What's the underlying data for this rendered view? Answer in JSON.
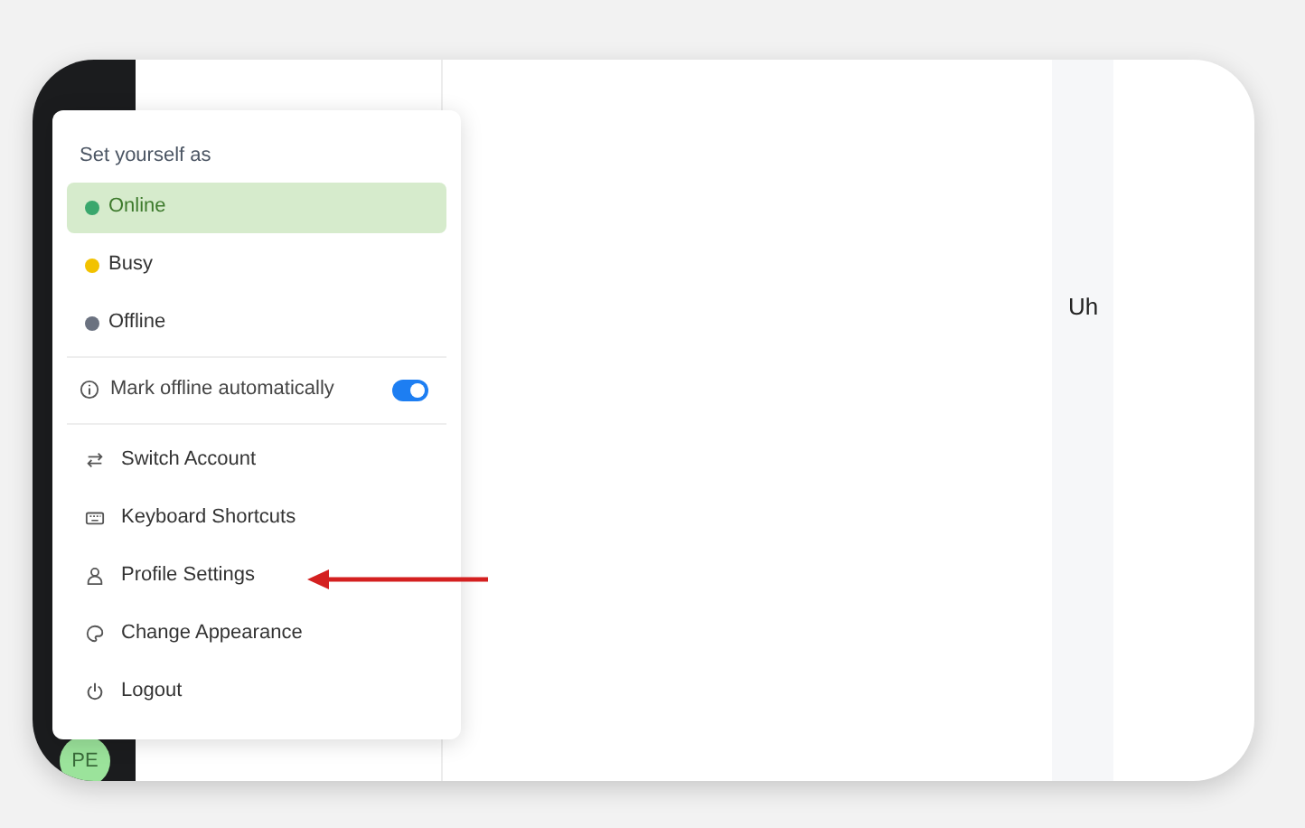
{
  "status_menu": {
    "heading": "Set yourself as",
    "statuses": [
      {
        "label": "Online",
        "color": "#3aa76d",
        "selected": true
      },
      {
        "label": "Busy",
        "color": "#f2c200",
        "selected": false
      },
      {
        "label": "Offline",
        "color": "#6b7280",
        "selected": false
      }
    ],
    "auto_offline": {
      "label": "Mark offline automatically",
      "on": true
    },
    "actions": [
      {
        "label": "Switch Account"
      },
      {
        "label": "Keyboard Shortcuts"
      },
      {
        "label": "Profile Settings"
      },
      {
        "label": "Change Appearance"
      },
      {
        "label": "Logout"
      }
    ]
  },
  "avatar": {
    "initials": "PE"
  },
  "main": {
    "message": "Uh"
  }
}
